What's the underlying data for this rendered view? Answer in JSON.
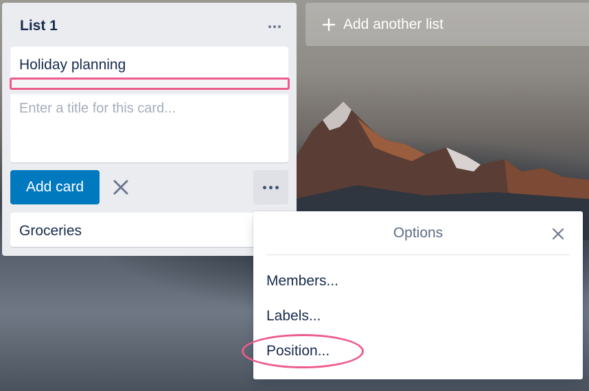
{
  "list": {
    "title": "List 1",
    "cards": [
      "Holiday planning",
      "Groceries"
    ],
    "composer_placeholder": "Enter a title for this card...",
    "add_card_label": "Add card"
  },
  "add_list": {
    "label": "Add another list"
  },
  "options_popover": {
    "title": "Options",
    "items": [
      "Members...",
      "Labels...",
      "Position..."
    ]
  },
  "colors": {
    "primary_button": "#0079bf",
    "highlight": "#ee5b8a",
    "list_bg": "#ebecf0",
    "text": "#172b4d"
  },
  "icons": [
    "more-horizontal-icon",
    "close-icon",
    "plus-icon"
  ]
}
